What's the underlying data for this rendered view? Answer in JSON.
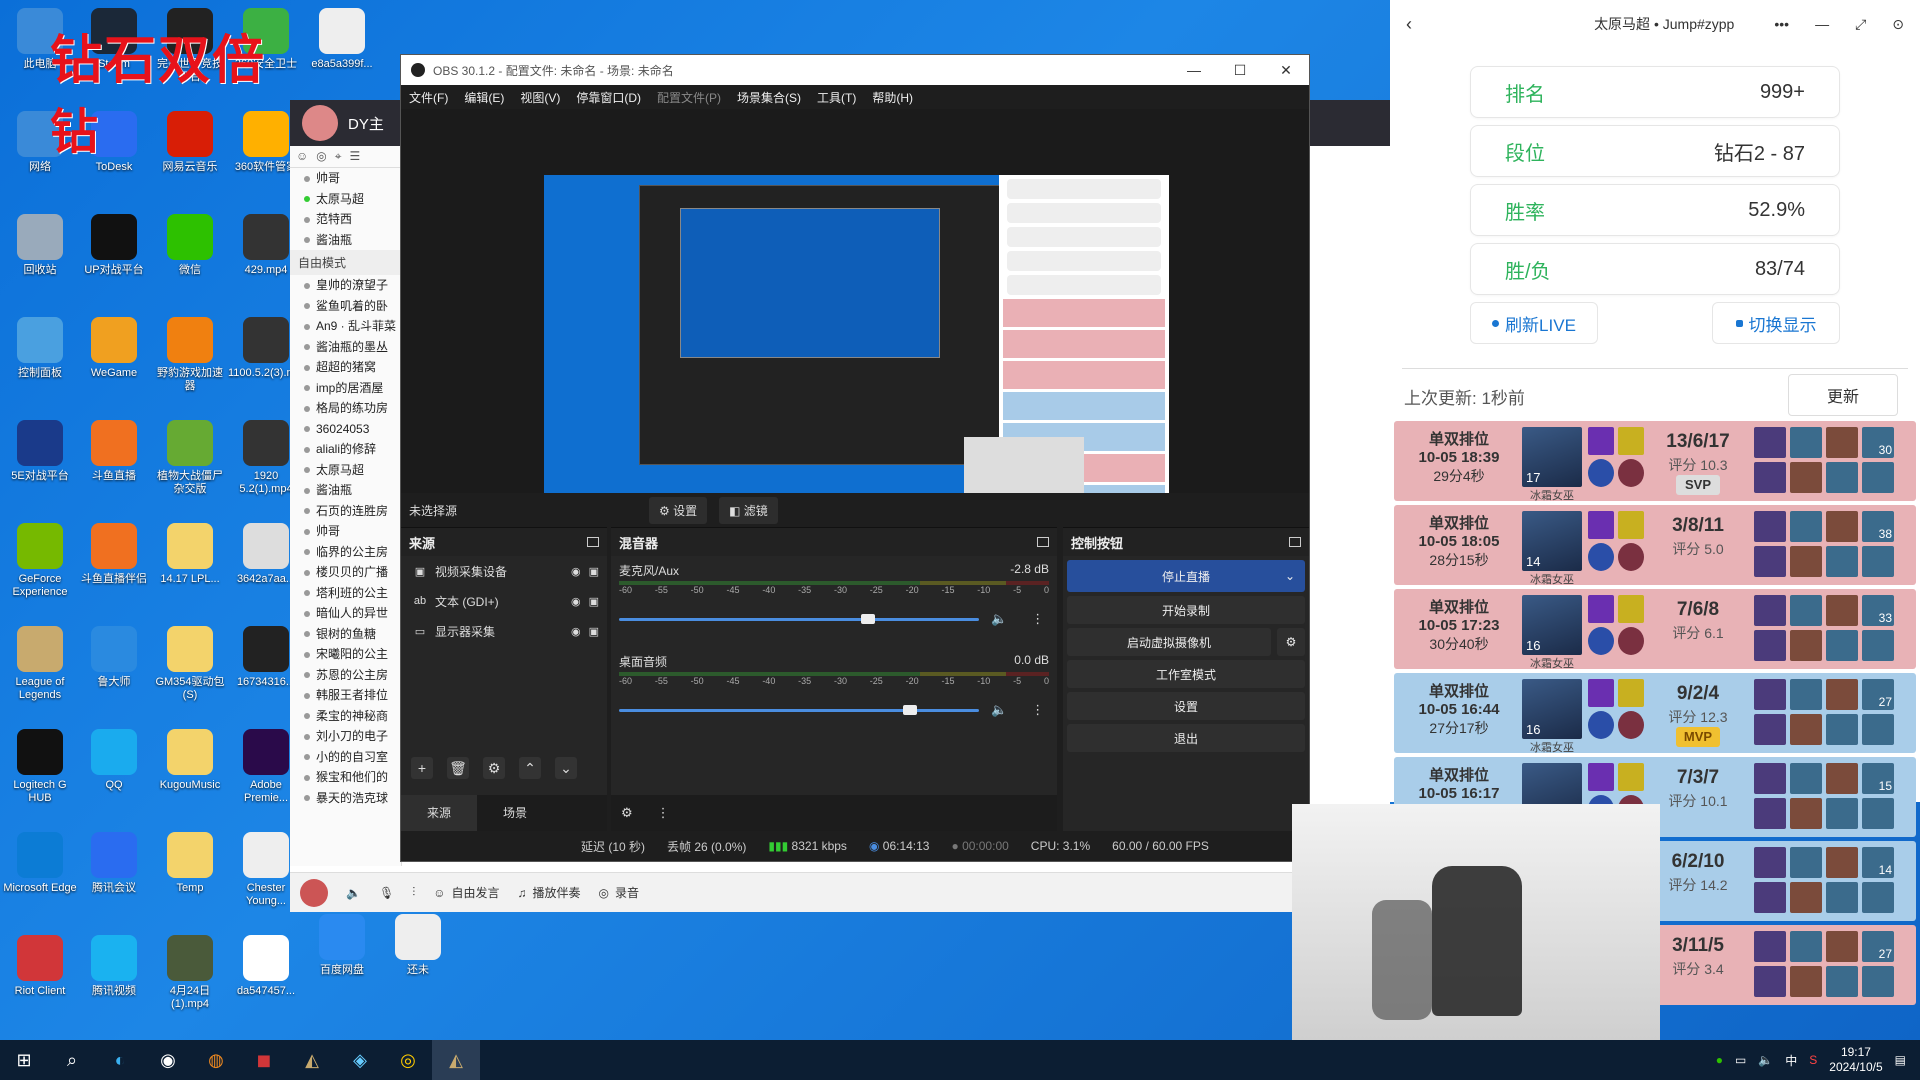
{
  "desktop": {
    "overlay_title": "钻石双倍",
    "overlay_sub": "钻",
    "icons": [
      {
        "label": "此电脑",
        "color": "#3a8ad8"
      },
      {
        "label": "Steam",
        "color": "#1b2838"
      },
      {
        "label": "完美世界竞技平台",
        "color": "#222"
      },
      {
        "label": "360安全卫士",
        "color": "#3cb043"
      },
      {
        "label": "e8a5a399f...",
        "color": "#eee"
      },
      {
        "label": "网络",
        "color": "#3a8ad8"
      },
      {
        "label": "ToDesk",
        "color": "#2a6cf0"
      },
      {
        "label": "网易云音乐",
        "color": "#d81e06"
      },
      {
        "label": "360软件管家",
        "color": "#ffb000"
      },
      {
        "label": "回收站",
        "color": "#9ab"
      },
      {
        "label": "UP对战平台",
        "color": "#111"
      },
      {
        "label": "微信",
        "color": "#2dc100"
      },
      {
        "label": "429.mp4",
        "color": "#333"
      },
      {
        "label": "控制面板",
        "color": "#4aa0e0"
      },
      {
        "label": "WeGame",
        "color": "#f0a020"
      },
      {
        "label": "野豹游戏加速器",
        "color": "#f08010"
      },
      {
        "label": "1100.5.2(3).mp4",
        "color": "#333"
      },
      {
        "label": "5E对战平台",
        "color": "#1a3a8a"
      },
      {
        "label": "斗鱼直播",
        "color": "#f07020"
      },
      {
        "label": "植物大战僵尸杂交版",
        "color": "#6a3"
      },
      {
        "label": "1920 5.2(1).mp4",
        "color": "#333"
      },
      {
        "label": "GeForce Experience",
        "color": "#76b900"
      },
      {
        "label": "斗鱼直播伴侣",
        "color": "#f07020"
      },
      {
        "label": "14.17 LPL...",
        "color": "#f3d36b"
      },
      {
        "label": "3642a7aa...",
        "color": "#ddd"
      },
      {
        "label": "League of Legends",
        "color": "#c8aa6e"
      },
      {
        "label": "鲁大师",
        "color": "#2a8ae0"
      },
      {
        "label": "GM354驱动包 (S)",
        "color": "#f3d36b"
      },
      {
        "label": "16734316...",
        "color": "#222"
      },
      {
        "label": "Logitech G HUB",
        "color": "#111"
      },
      {
        "label": "QQ",
        "color": "#1aabee"
      },
      {
        "label": "KugouMusic",
        "color": "#f3d36b"
      },
      {
        "label": "Adobe Premie...",
        "color": "#2a0a4a"
      },
      {
        "label": "Microsoft Edge",
        "color": "#0c7cd5"
      },
      {
        "label": "腾讯会议",
        "color": "#2a6cf0"
      },
      {
        "label": "Temp",
        "color": "#f3d36b"
      },
      {
        "label": "Chester Young...",
        "color": "#eee"
      },
      {
        "label": "Riot Client",
        "color": "#d13639"
      },
      {
        "label": "腾讯视频",
        "color": "#1ab2f0"
      },
      {
        "label": "4月24日(1).mp4",
        "color": "#4a5a3a"
      },
      {
        "label": "da547457...",
        "color": "#fff"
      },
      {
        "label": "百度网盘",
        "color": "#2a8af0"
      },
      {
        "label": "还未",
        "color": "#eee"
      }
    ]
  },
  "dy_window": {
    "title": "DY主",
    "favorites": [
      {
        "label": "帅哥",
        "green": false
      },
      {
        "label": "太原马超",
        "green": true
      },
      {
        "label": "范特西",
        "green": false
      },
      {
        "label": "酱油瓶",
        "green": false
      }
    ],
    "section": "自由模式",
    "rows": [
      "皇帅的潦望子",
      "鲨鱼叽着的卧",
      "An9 · 乱斗菲菜",
      "酱油瓶的墨丛",
      "超超的猪窝",
      "imp的居酒屋",
      "格局的练功房",
      "36024053",
      "aliali的修辞",
      "太原马超",
      "酱油瓶",
      "石页的连胜房",
      "帅哥",
      "临界的公主房",
      "楼贝贝的广播",
      "塔利班的公主",
      "暗仙人的异世",
      "银树的鱼糖",
      "宋曦阳的公主",
      "苏恩的公主房",
      "韩服王者排位",
      "柔宝的神秘商",
      "刘小刀的电子",
      "小的的自习室",
      "猴宝和他们的",
      "暴天的浩克球"
    ],
    "bottom": {
      "free_speech": "自由发言",
      "play_music": "播放伴奏",
      "record": "录音"
    }
  },
  "obs": {
    "title": "OBS 30.1.2 - 配置文件: 未命名 - 场景: 未命名",
    "menu": [
      "文件(F)",
      "编辑(E)",
      "视图(V)",
      "停靠窗口(D)",
      "配置文件(P)",
      "场景集合(S)",
      "工具(T)",
      "帮助(H)"
    ],
    "no_source": "未选择源",
    "settings_btn": "设置",
    "filters_btn": "滤镜",
    "sources": {
      "title": "来源",
      "items": [
        {
          "label": "视频采集设备",
          "icon": "▣"
        },
        {
          "label": "文本 (GDI+)",
          "icon": "ab"
        },
        {
          "label": "显示器采集",
          "icon": "▭"
        }
      ],
      "tab_sources": "来源",
      "tab_scenes": "场景"
    },
    "mixer": {
      "title": "混音器",
      "scale": [
        "-60",
        "-55",
        "-50",
        "-45",
        "-40",
        "-35",
        "-30",
        "-25",
        "-20",
        "-15",
        "-10",
        "-5",
        "0"
      ],
      "channels": [
        {
          "name": "麦克风/Aux",
          "db": "-2.8 dB",
          "level": 0.7
        },
        {
          "name": "桌面音频",
          "db": "0.0 dB",
          "level": 0.82
        }
      ]
    },
    "controls": {
      "title": "控制按钮",
      "stop_stream": "停止直播",
      "start_record": "开始录制",
      "virtual_cam": "启动虚拟摄像机",
      "studio_mode": "工作室模式",
      "settings": "设置",
      "exit": "退出"
    },
    "status": {
      "delay": "延迟 (10 秒)",
      "dropped": "丢帧 26 (0.0%)",
      "bitrate": "8321 kbps",
      "stream_time": "06:14:13",
      "record_time": "00:00:00",
      "cpu": "CPU: 3.1%",
      "fps": "60.00 / 60.00 FPS"
    }
  },
  "stats": {
    "title": "太原马超 • Jump#zypp",
    "cards": [
      {
        "label": "排名",
        "value": "999+"
      },
      {
        "label": "段位",
        "value": "钻石2 - 87"
      },
      {
        "label": "胜率",
        "value": "52.9%"
      },
      {
        "label": "胜/负",
        "value": "83/74"
      }
    ],
    "refresh_live": "刷新LIVE",
    "toggle_display": "切换显示",
    "last_update": "上次更新: 1秒前",
    "update_btn": "更新",
    "matches": [
      {
        "mode": "单双排位",
        "date": "10-05 18:39",
        "dur": "29分4秒",
        "level": "17",
        "champion": "冰霜女巫",
        "kda": "13/6/17",
        "score": "评分 10.3",
        "badge": "SVP",
        "result": "red",
        "item_num": "30"
      },
      {
        "mode": "单双排位",
        "date": "10-05 18:05",
        "dur": "28分15秒",
        "level": "14",
        "champion": "冰霜女巫",
        "kda": "3/8/11",
        "score": "评分 5.0",
        "badge": "",
        "result": "red",
        "item_num": "38"
      },
      {
        "mode": "单双排位",
        "date": "10-05 17:23",
        "dur": "30分40秒",
        "level": "16",
        "champion": "冰霜女巫",
        "kda": "7/6/8",
        "score": "评分 6.1",
        "badge": "",
        "result": "red",
        "item_num": "33"
      },
      {
        "mode": "单双排位",
        "date": "10-05 16:44",
        "dur": "27分17秒",
        "level": "16",
        "champion": "冰霜女巫",
        "kda": "9/2/4",
        "score": "评分 12.3",
        "badge": "MVP",
        "result": "blue",
        "item_num": "27"
      },
      {
        "mode": "单双排位",
        "date": "10-05 16:17",
        "dur": "",
        "level": "",
        "champion": "",
        "kda": "7/3/7",
        "score": "评分 10.1",
        "badge": "",
        "result": "blue",
        "item_num": "15"
      },
      {
        "mode": "",
        "date": "",
        "dur": "",
        "level": "",
        "champion": "",
        "kda": "6/2/10",
        "score": "评分 14.2",
        "badge": "",
        "result": "blue",
        "item_num": "14"
      },
      {
        "mode": "",
        "date": "",
        "dur": "",
        "level": "",
        "champion": "",
        "kda": "3/11/5",
        "score": "评分 3.4",
        "badge": "",
        "result": "red",
        "item_num": "27"
      }
    ]
  },
  "taskbar": {
    "time": "19:17",
    "date": "2024/10/5",
    "ime": "中"
  }
}
